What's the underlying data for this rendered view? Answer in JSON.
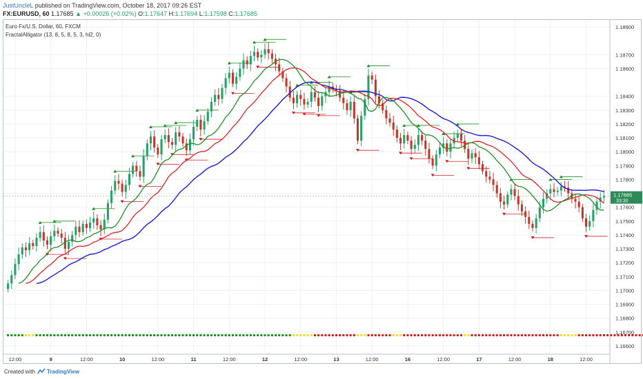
{
  "header": {
    "author": "JustUncleL",
    "published": "published on TradingView.com, October 18, 2017 09:26 EST",
    "symbol": "FX:EURUSD, 60",
    "last": "1.17685",
    "change": "▲ +0.00026 (+0.02%)",
    "o_label": "O:",
    "o": "1.17647",
    "h_label": "H:",
    "h": "1.17694",
    "l_label": "L:",
    "l": "1.17598",
    "c_label": "C:",
    "c": "1.17685"
  },
  "legend": {
    "series_title": "Euro Fx/U.S. Dollar, 60, FXCM",
    "indicator": "FractalAlligator (13, 8, 5, 8, 5, 3, hl2, 0)"
  },
  "price_tag": {
    "value": "1.17685",
    "countdown": "33:30"
  },
  "footer": {
    "created_with": "Created with",
    "brand": "TradingView"
  },
  "colors": {
    "up_candle": "#26a269",
    "down_candle": "#c0392b",
    "jaw": "#1a1ad6",
    "teeth": "#e02020",
    "lips": "#1f8f1f",
    "fractal_up": "#1f8f1f",
    "fractal_down": "#d02020",
    "signal_cyan": "#22c4e0",
    "signal_magenta": "#d030d0"
  },
  "chart_data": {
    "type": "candlestick",
    "y_ticks": [
      "1.18900",
      "1.18700",
      "1.18600",
      "1.18400",
      "1.18300",
      "1.18200",
      "1.18100",
      "1.18000",
      "1.17900",
      "1.17800",
      "1.17700",
      "1.17600",
      "1.17500",
      "1.17400",
      "1.17300",
      "1.17200",
      "1.17100",
      "1.17000",
      "1.16900",
      "1.16800",
      "1.16700",
      "1.16600"
    ],
    "y_tick_values": [
      1.189,
      1.187,
      1.186,
      1.184,
      1.183,
      1.182,
      1.181,
      1.18,
      1.179,
      1.178,
      1.177,
      1.176,
      1.175,
      1.174,
      1.173,
      1.172,
      1.171,
      1.17,
      1.169,
      1.168,
      1.167,
      1.166
    ],
    "ylim": [
      1.1655,
      1.1895
    ],
    "x_tick_labels": [
      "12:00",
      "9",
      "12:00",
      "10",
      "12:00",
      "11",
      "12:00",
      "12",
      "12:00",
      "13",
      "12:00",
      "16",
      "12:00",
      "17",
      "12:00",
      "18",
      "12:00"
    ],
    "x_tick_bars": [
      2,
      12,
      22,
      32,
      42,
      52,
      62,
      72,
      82,
      92,
      102,
      112,
      122,
      132,
      142,
      152,
      162
    ],
    "close": [
      1.1705,
      1.1711,
      1.1719,
      1.1726,
      1.1731,
      1.1729,
      1.1734,
      1.1732,
      1.1738,
      1.1742,
      1.1736,
      1.1733,
      1.1739,
      1.1743,
      1.1741,
      1.1738,
      1.173,
      1.1735,
      1.174,
      1.1746,
      1.1742,
      1.1748,
      1.1745,
      1.1749,
      1.1752,
      1.1747,
      1.1744,
      1.1751,
      1.1763,
      1.1772,
      1.1779,
      1.1777,
      1.1771,
      1.1776,
      1.1784,
      1.179,
      1.1786,
      1.1782,
      1.1797,
      1.1806,
      1.1811,
      1.1803,
      1.1798,
      1.1809,
      1.1812,
      1.1807,
      1.1805,
      1.1814,
      1.1811,
      1.1806,
      1.1801,
      1.1809,
      1.1818,
      1.1823,
      1.1816,
      1.1822,
      1.1829,
      1.1836,
      1.1841,
      1.1838,
      1.1846,
      1.1853,
      1.1857,
      1.1849,
      1.1854,
      1.186,
      1.1866,
      1.1863,
      1.1869,
      1.1872,
      1.1868,
      1.187,
      1.1874,
      1.1871,
      1.1867,
      1.1863,
      1.1858,
      1.1853,
      1.1847,
      1.1839,
      1.1835,
      1.1841,
      1.1838,
      1.1834,
      1.1836,
      1.1843,
      1.1839,
      1.1833,
      1.184,
      1.1843,
      1.1847,
      1.1845,
      1.1844,
      1.1839,
      1.1835,
      1.183,
      1.1836,
      1.1824,
      1.1808,
      1.1826,
      1.1838,
      1.1855,
      1.1852,
      1.184,
      1.1835,
      1.183,
      1.1824,
      1.1821,
      1.1816,
      1.181,
      1.1806,
      1.1812,
      1.1808,
      1.1802,
      1.1805,
      1.1812,
      1.1808,
      1.1802,
      1.1795,
      1.179,
      1.1798,
      1.1803,
      1.1806,
      1.18,
      1.1806,
      1.181,
      1.1813,
      1.1808,
      1.1802,
      1.1795,
      1.1799,
      1.1796,
      1.1791,
      1.1786,
      1.1782,
      1.178,
      1.1776,
      1.177,
      1.1764,
      1.1762,
      1.1769,
      1.1773,
      1.1768,
      1.1762,
      1.1757,
      1.1753,
      1.1748,
      1.1745,
      1.1752,
      1.176,
      1.1766,
      1.177,
      1.1773,
      1.1771,
      1.1772,
      1.1775,
      1.1774,
      1.177,
      1.1766,
      1.1764,
      1.176,
      1.1752,
      1.1746,
      1.175,
      1.1758,
      1.1764,
      1.1767,
      1.1768
    ],
    "series": [
      {
        "name": "jaw"
      },
      {
        "name": "teeth"
      },
      {
        "name": "lips"
      }
    ],
    "trend_bar_colors": [
      "green",
      "green",
      "green",
      "green",
      "green",
      "yellow",
      "yellow",
      "yellow",
      "green",
      "green",
      "green",
      "green",
      "green",
      "green",
      "green",
      "green",
      "green",
      "green",
      "green",
      "green",
      "green",
      "green",
      "green",
      "green",
      "green",
      "green",
      "green",
      "green",
      "green",
      "green",
      "green",
      "green",
      "green",
      "green",
      "green",
      "green",
      "green",
      "green",
      "green",
      "green",
      "green",
      "green",
      "green",
      "green",
      "green",
      "green",
      "green",
      "green",
      "green",
      "green",
      "green",
      "green",
      "green",
      "green",
      "green",
      "green",
      "green",
      "green",
      "green",
      "green",
      "green",
      "green",
      "green",
      "green",
      "green",
      "green",
      "green",
      "green",
      "green",
      "green",
      "green",
      "green",
      "green",
      "green",
      "green",
      "green",
      "green",
      "green",
      "green",
      "green",
      "yellow",
      "yellow",
      "yellow",
      "yellow",
      "yellow",
      "yellow",
      "red",
      "red",
      "red",
      "red",
      "red",
      "red",
      "red",
      "red",
      "red",
      "red",
      "red",
      "red",
      "yellow",
      "yellow",
      "yellow",
      "red",
      "red",
      "red",
      "red",
      "red",
      "red",
      "red",
      "yellow",
      "yellow",
      "yellow",
      "red",
      "red",
      "red",
      "red",
      "red",
      "red",
      "red",
      "red",
      "red",
      "red",
      "red",
      "red",
      "red",
      "red",
      "red",
      "red",
      "red",
      "yellow",
      "yellow",
      "red",
      "red",
      "red",
      "red",
      "red",
      "red",
      "red",
      "red",
      "red",
      "red",
      "red",
      "red",
      "red",
      "red",
      "red",
      "red",
      "red",
      "red",
      "red",
      "red",
      "red",
      "red",
      "red",
      "red",
      "red",
      "yellow",
      "yellow",
      "yellow",
      "yellow",
      "yellow",
      "red",
      "red",
      "red",
      "red",
      "red",
      "red",
      "red",
      "red",
      "red",
      "red",
      "red",
      "red",
      "red",
      "red",
      "red",
      "red",
      "red",
      "red",
      "red"
    ]
  }
}
